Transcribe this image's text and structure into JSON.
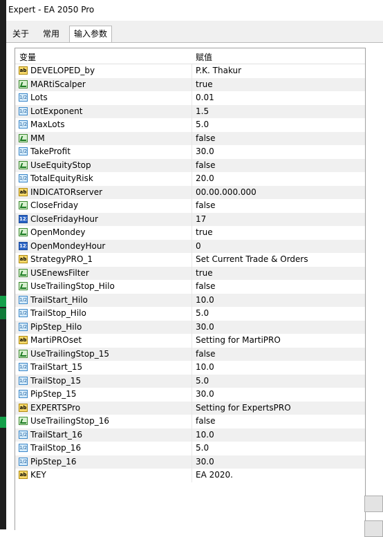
{
  "window": {
    "title": "Expert - EA 2050 Pro"
  },
  "tabs": [
    {
      "label": "关于"
    },
    {
      "label": "常用"
    },
    {
      "label": "输入参数"
    }
  ],
  "table": {
    "headers": {
      "variable": "变量",
      "value": "赋值"
    },
    "rows": [
      {
        "icon": "ab",
        "name": "DEVELOPED_by",
        "value": "P.K. Thakur"
      },
      {
        "icon": "bool",
        "name": "MARtiScalper",
        "value": "true"
      },
      {
        "icon": "dbl",
        "name": "Lots",
        "value": "0.01"
      },
      {
        "icon": "dbl",
        "name": "LotExponent",
        "value": "1.5"
      },
      {
        "icon": "dbl",
        "name": "MaxLots",
        "value": "5.0"
      },
      {
        "icon": "bool",
        "name": "MM",
        "value": "false"
      },
      {
        "icon": "dbl",
        "name": "TakeProfit",
        "value": "30.0"
      },
      {
        "icon": "bool",
        "name": "UseEquityStop",
        "value": "false"
      },
      {
        "icon": "dbl",
        "name": "TotalEquityRisk",
        "value": "20.0"
      },
      {
        "icon": "ab",
        "name": "INDICATORserver",
        "value": "00.00.000.000"
      },
      {
        "icon": "bool",
        "name": "CloseFriday",
        "value": "false"
      },
      {
        "icon": "int",
        "name": "CloseFridayHour",
        "value": "17"
      },
      {
        "icon": "bool",
        "name": "OpenMondey",
        "value": "true"
      },
      {
        "icon": "int",
        "name": "OpenMondeyHour",
        "value": "0"
      },
      {
        "icon": "ab",
        "name": "StrategyPRO_1",
        "value": "Set Current Trade & Orders"
      },
      {
        "icon": "bool",
        "name": "USEnewsFilter",
        "value": "true"
      },
      {
        "icon": "bool",
        "name": "UseTrailingStop_Hilo",
        "value": "false"
      },
      {
        "icon": "dbl",
        "name": "TrailStart_Hilo",
        "value": "10.0"
      },
      {
        "icon": "dbl",
        "name": "TrailStop_Hilo",
        "value": "5.0"
      },
      {
        "icon": "dbl",
        "name": "PipStep_Hilo",
        "value": "30.0"
      },
      {
        "icon": "ab",
        "name": "MartiPROset",
        "value": "Setting for MartiPRO"
      },
      {
        "icon": "bool",
        "name": "UseTrailingStop_15",
        "value": "false"
      },
      {
        "icon": "dbl",
        "name": "TrailStart_15",
        "value": "10.0"
      },
      {
        "icon": "dbl",
        "name": "TrailStop_15",
        "value": "5.0"
      },
      {
        "icon": "dbl",
        "name": "PipStep_15",
        "value": "30.0"
      },
      {
        "icon": "ab",
        "name": "EXPERTSPro",
        "value": "Setting for ExpertsPRO"
      },
      {
        "icon": "bool",
        "name": "UseTrailingStop_16",
        "value": "false"
      },
      {
        "icon": "dbl",
        "name": "TrailStart_16",
        "value": "10.0"
      },
      {
        "icon": "dbl",
        "name": "TrailStop_16",
        "value": "5.0"
      },
      {
        "icon": "dbl",
        "name": "PipStep_16",
        "value": "30.0"
      },
      {
        "icon": "ab",
        "name": "KEY",
        "value": "EA 2020."
      }
    ]
  },
  "icons": {
    "ab": {
      "name": "string-type-icon",
      "glyph": "ab"
    },
    "bool": {
      "name": "bool-type-icon",
      "glyph": ""
    },
    "dbl": {
      "name": "double-type-icon",
      "glyph": "1/2"
    },
    "int": {
      "name": "integer-type-icon",
      "glyph": "123"
    }
  }
}
